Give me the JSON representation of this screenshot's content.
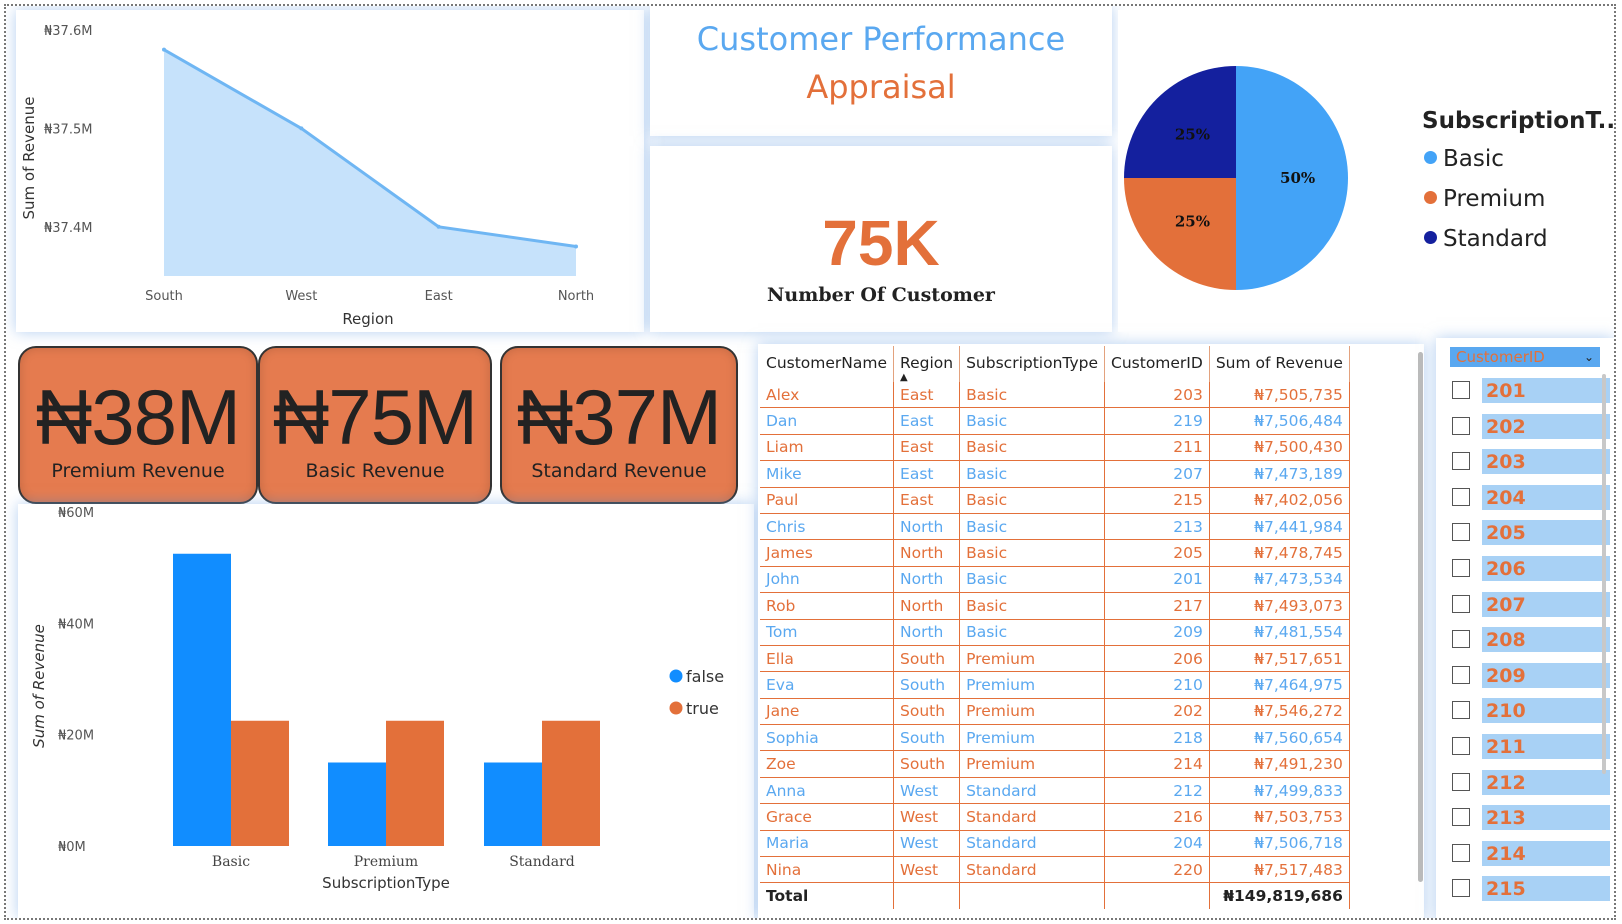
{
  "header": {
    "title_line1": "Customer Performance",
    "title_line2": "Appraisal"
  },
  "kpi": {
    "value": "75K",
    "label": "Number Of Customer"
  },
  "cards": [
    {
      "value": "₦38M",
      "label": "Premium Revenue"
    },
    {
      "value": "₦75M",
      "label": "Basic Revenue"
    },
    {
      "value": "₦37M",
      "label": "Standard Revenue"
    }
  ],
  "colors": {
    "blue": "#5aa8f0",
    "orange": "#e3703a",
    "navy": "#14209e",
    "bright_blue": "#118dff",
    "pie_blue": "#43a3f7"
  },
  "chart_data": [
    {
      "type": "area",
      "categories": [
        "South",
        "West",
        "East",
        "North"
      ],
      "values": [
        37.58,
        37.5,
        37.4,
        37.38
      ],
      "ytick_labels": [
        "₦37.6M",
        "₦37.5M",
        "₦37.4M"
      ],
      "ytick_values": [
        37.6,
        37.5,
        37.4
      ],
      "xlabel": "Region",
      "ylabel": "Sum of Revenue",
      "ylim": [
        37.35,
        37.6
      ]
    },
    {
      "type": "pie",
      "legend_title": "SubscriptionT...",
      "labels": [
        "Basic",
        "Premium",
        "Standard"
      ],
      "values": [
        50,
        25,
        25
      ],
      "value_labels": [
        "50%",
        "25%",
        "25%"
      ],
      "legend_position": "right"
    },
    {
      "type": "bar",
      "categories": [
        "Basic",
        "Premium",
        "Standard"
      ],
      "series": [
        {
          "name": "false",
          "values": [
            52.5,
            15,
            15
          ]
        },
        {
          "name": "true",
          "values": [
            22.5,
            22.5,
            22.5
          ]
        }
      ],
      "ytick_labels": [
        "₦60M",
        "₦40M",
        "₦20M",
        "₦0M"
      ],
      "ytick_values": [
        60,
        40,
        20,
        0
      ],
      "xlabel": "SubscriptionType",
      "ylabel": "Sum of Revenue",
      "ylim": [
        0,
        60
      ],
      "legend_position": "right"
    }
  ],
  "table": {
    "columns": [
      "CustomerName",
      "Region",
      "SubscriptionType",
      "CustomerID",
      "Sum of Revenue"
    ],
    "rows": [
      [
        "Alex",
        "East",
        "Basic",
        "203",
        "₦7,505,735"
      ],
      [
        "Dan",
        "East",
        "Basic",
        "219",
        "₦7,506,484"
      ],
      [
        "Liam",
        "East",
        "Basic",
        "211",
        "₦7,500,430"
      ],
      [
        "Mike",
        "East",
        "Basic",
        "207",
        "₦7,473,189"
      ],
      [
        "Paul",
        "East",
        "Basic",
        "215",
        "₦7,402,056"
      ],
      [
        "Chris",
        "North",
        "Basic",
        "213",
        "₦7,441,984"
      ],
      [
        "James",
        "North",
        "Basic",
        "205",
        "₦7,478,745"
      ],
      [
        "John",
        "North",
        "Basic",
        "201",
        "₦7,473,534"
      ],
      [
        "Rob",
        "North",
        "Basic",
        "217",
        "₦7,493,073"
      ],
      [
        "Tom",
        "North",
        "Basic",
        "209",
        "₦7,481,554"
      ],
      [
        "Ella",
        "South",
        "Premium",
        "206",
        "₦7,517,651"
      ],
      [
        "Eva",
        "South",
        "Premium",
        "210",
        "₦7,464,975"
      ],
      [
        "Jane",
        "South",
        "Premium",
        "202",
        "₦7,546,272"
      ],
      [
        "Sophia",
        "South",
        "Premium",
        "218",
        "₦7,560,654"
      ],
      [
        "Zoe",
        "South",
        "Premium",
        "214",
        "₦7,491,230"
      ],
      [
        "Anna",
        "West",
        "Standard",
        "212",
        "₦7,499,833"
      ],
      [
        "Grace",
        "West",
        "Standard",
        "216",
        "₦7,503,753"
      ],
      [
        "Maria",
        "West",
        "Standard",
        "204",
        "₦7,506,718"
      ],
      [
        "Nina",
        "West",
        "Standard",
        "220",
        "₦7,517,483"
      ]
    ],
    "total_label": "Total",
    "total_value": "₦149,819,686"
  },
  "slicer": {
    "header": "CustomerID",
    "items": [
      "201",
      "202",
      "203",
      "204",
      "205",
      "206",
      "207",
      "208",
      "209",
      "210",
      "211",
      "212",
      "213",
      "214",
      "215"
    ]
  }
}
